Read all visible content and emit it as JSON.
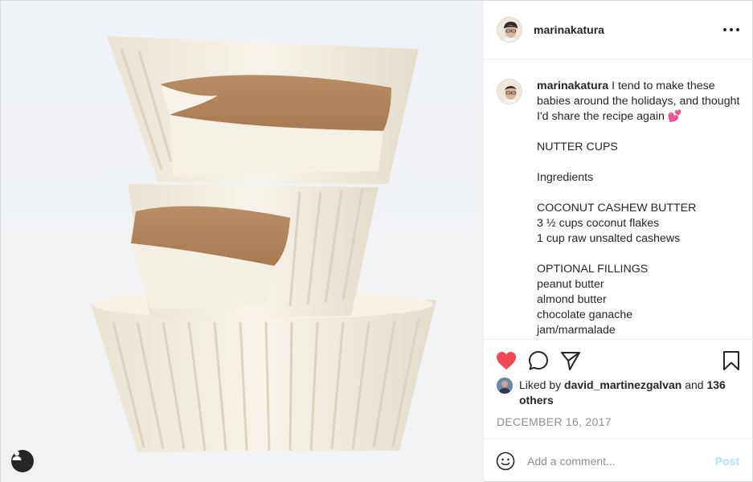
{
  "post": {
    "author": "marinakatura",
    "caption": {
      "username": "marinakatura",
      "first_line": "I tend to make these babies around the holidays, and thought I'd share the recipe again 💕",
      "lines": [
        "",
        "NUTTER CUPS",
        "",
        "Ingredients",
        "",
        "COCONUT CASHEW BUTTER",
        "3 ½ cups coconut flakes",
        "1 cup raw unsalted cashews",
        "",
        "OPTIONAL FILLINGS",
        "peanut butter",
        "almond butter",
        "chocolate ganache",
        "jam/marmalade"
      ]
    },
    "likes": {
      "prefix": "Liked by",
      "user": "david_martinezgalvan",
      "middle": "and",
      "others": "136 others"
    },
    "date": "DECEMBER 16, 2017",
    "comment_box": {
      "placeholder": "Add a comment...",
      "post_label": "Post"
    },
    "icons": {
      "like": "heart-icon",
      "comment": "comment-icon",
      "share": "share-icon",
      "save": "bookmark-icon",
      "more": "more-icon",
      "emoji": "emoji-icon",
      "tagged_user": "user-tag-icon"
    },
    "colors": {
      "like_red": "#ed4956",
      "post_disabled_blue": "#b2dffc",
      "text": "#262626",
      "muted": "#8e8e8e"
    }
  }
}
